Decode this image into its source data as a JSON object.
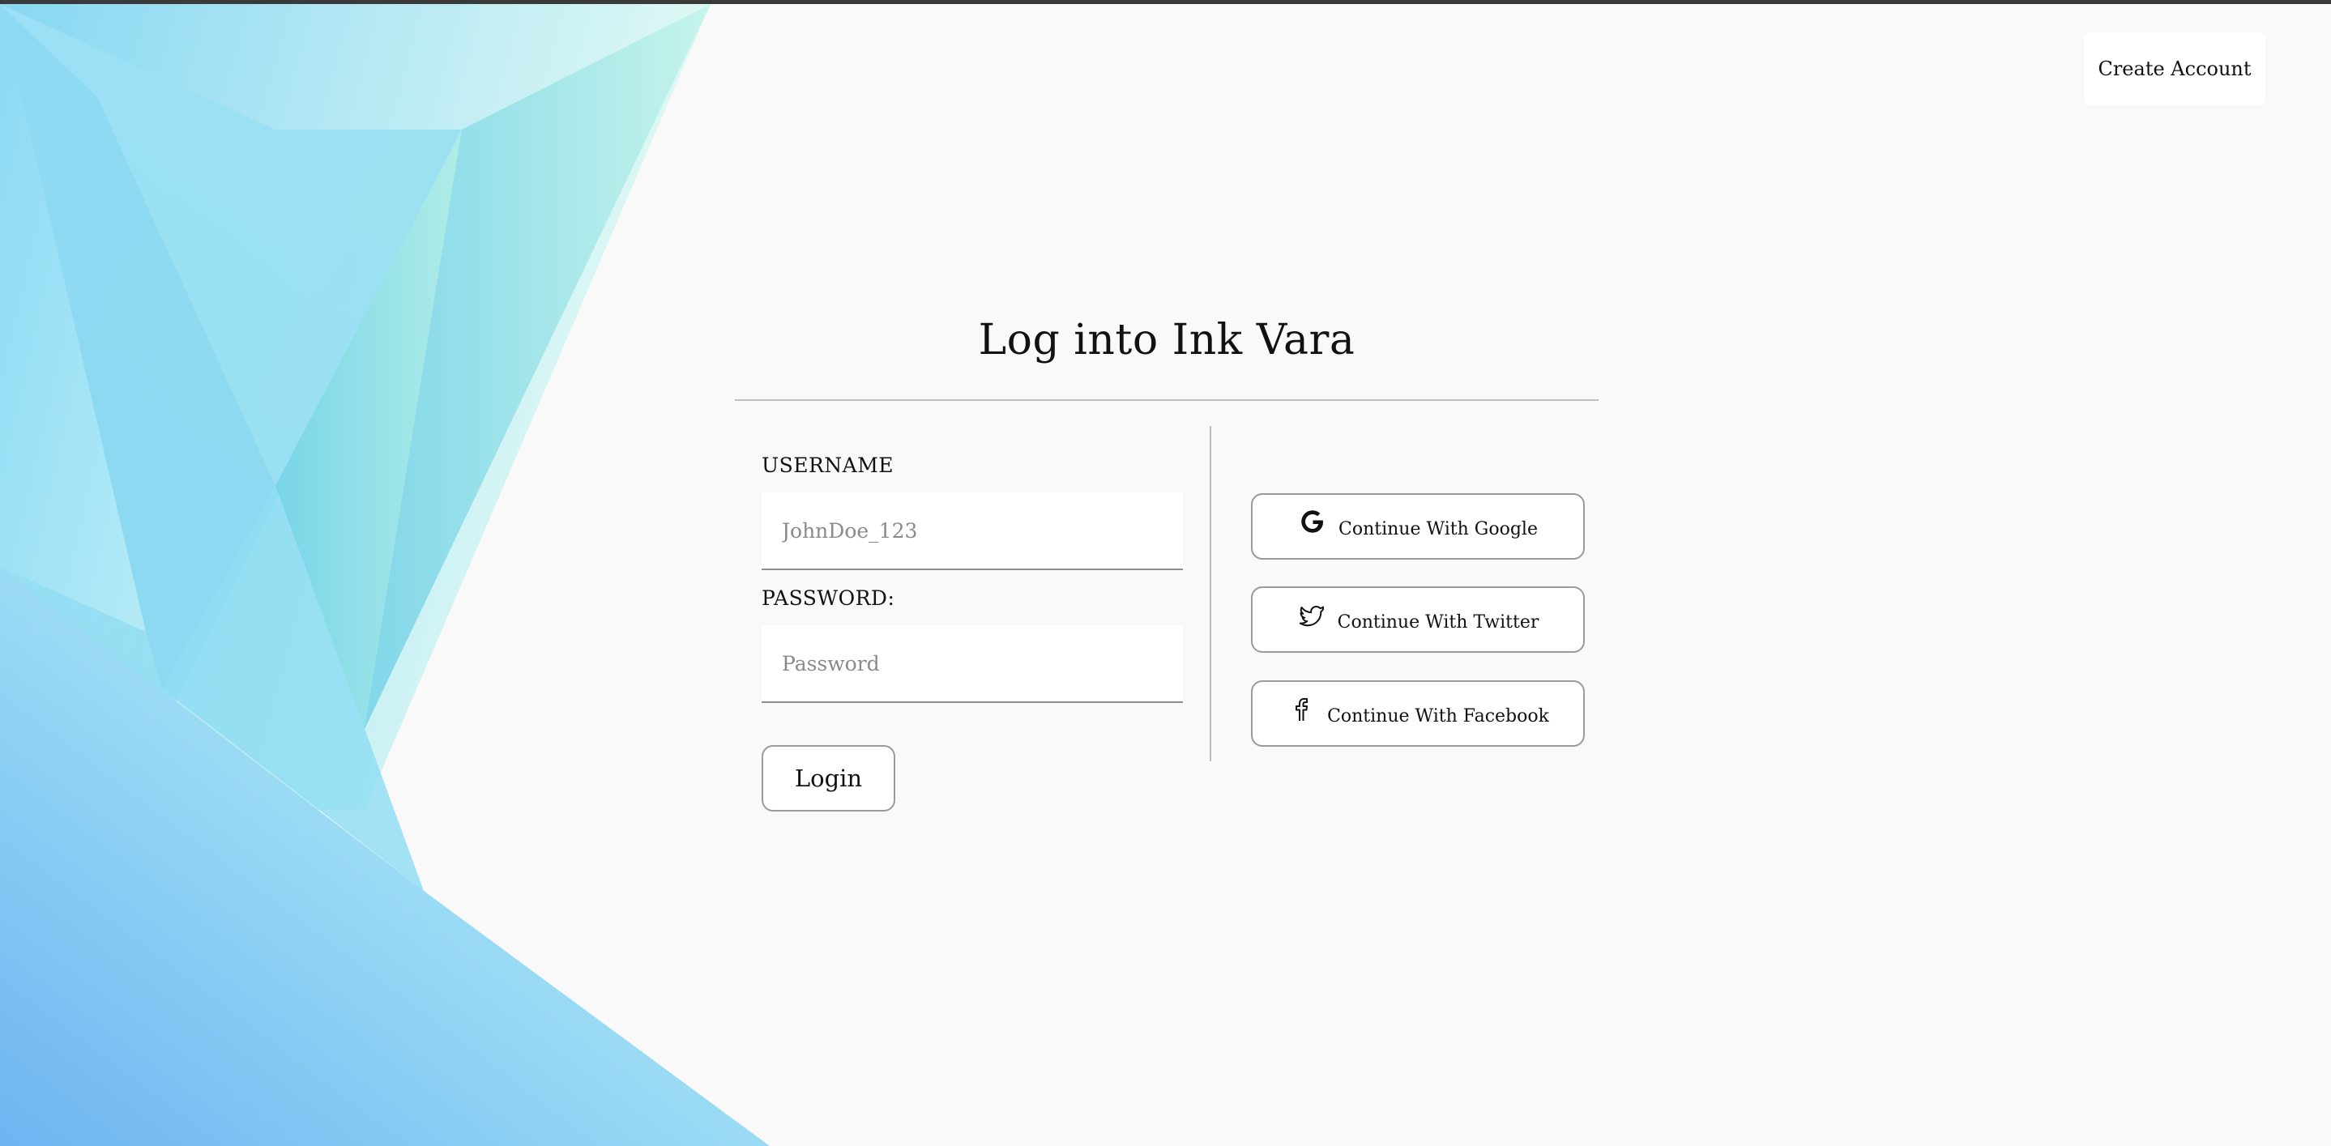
{
  "header": {
    "create_account_label": "Create Account"
  },
  "page": {
    "title": "Log into Ink Vara"
  },
  "form": {
    "username_label": "USERNAME",
    "username_placeholder": "JohnDoe_123",
    "username_value": "",
    "password_label": "PASSWORD:",
    "password_placeholder": "Password",
    "password_value": "",
    "login_label": "Login"
  },
  "social": [
    {
      "label": "Continue With Google",
      "icon": "google-icon"
    },
    {
      "label": "Continue With Twitter",
      "icon": "twitter-icon"
    },
    {
      "label": "Continue With Facebook",
      "icon": "facebook-icon"
    }
  ],
  "colors": {
    "background": "#f9f9f9",
    "accent_blue": "#7fd3f0",
    "accent_mint": "#a8ecdc"
  }
}
